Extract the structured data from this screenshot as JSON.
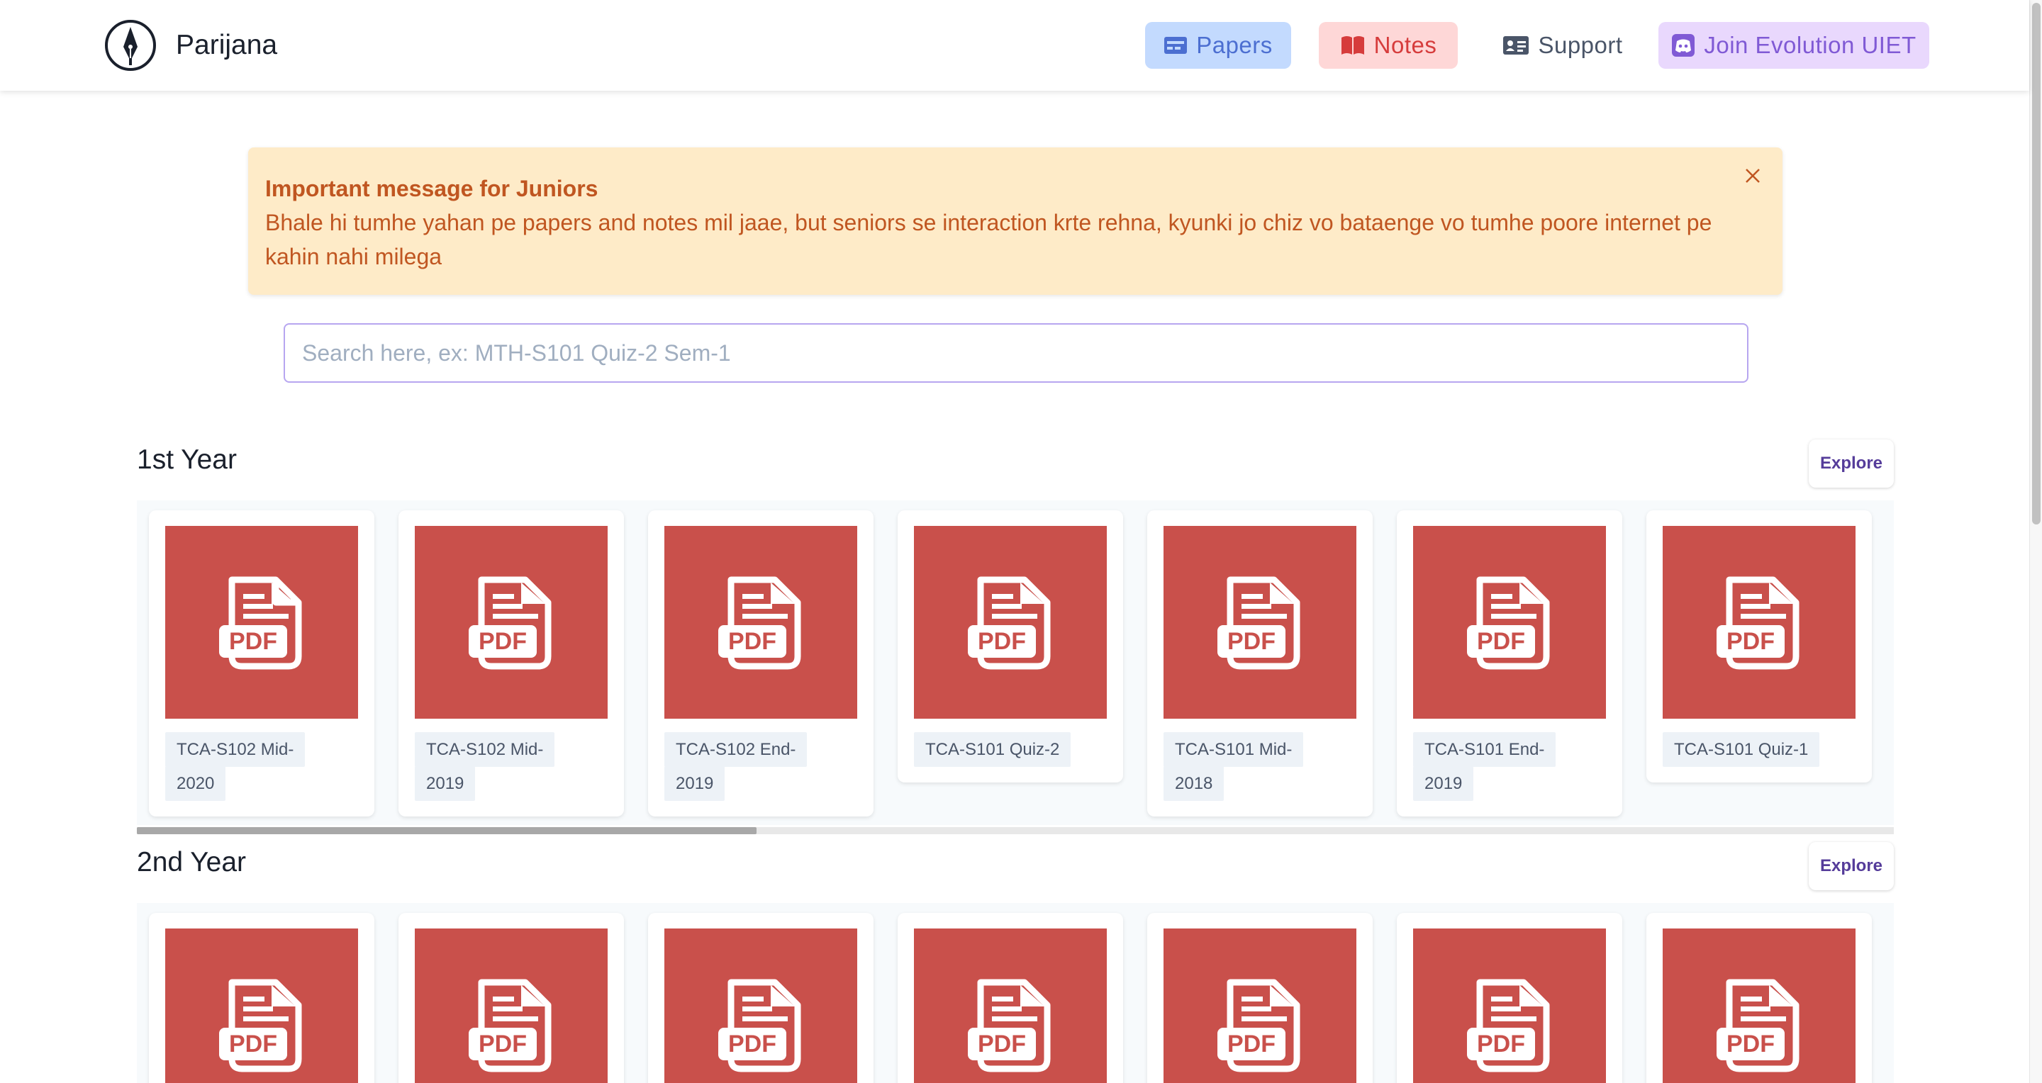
{
  "header": {
    "brand": "Parijana",
    "nav": {
      "papers": "Papers",
      "notes": "Notes",
      "support": "Support",
      "join": "Join Evolution UIET"
    }
  },
  "alert": {
    "title": "Important message for Juniors",
    "text": "Bhale hi tumhe yahan pe papers and notes mil jaae, but seniors se interaction krte rehna, kyunki jo chiz vo bataenge vo tumhe poore internet pe kahin nahi milega"
  },
  "search": {
    "placeholder": "Search here, ex: MTH-S101 Quiz-2 Sem-1"
  },
  "sections": [
    {
      "title": "1st Year",
      "explore": "Explore",
      "cards": [
        {
          "label": "TCA-S102 Mid-2020"
        },
        {
          "label": "TCA-S102 Mid-2019"
        },
        {
          "label": "TCA-S102 End-2019"
        },
        {
          "label": "TCA-S101 Quiz-2"
        },
        {
          "label": "TCA-S101 Mid-2018"
        },
        {
          "label": "TCA-S101 End-2019"
        },
        {
          "label": "TCA-S101 Quiz-1"
        }
      ]
    },
    {
      "title": "2nd Year",
      "explore": "Explore",
      "cards": [
        {
          "label": ""
        },
        {
          "label": ""
        },
        {
          "label": ""
        },
        {
          "label": ""
        },
        {
          "label": ""
        },
        {
          "label": ""
        },
        {
          "label": ""
        }
      ]
    }
  ],
  "pdf_icon_text": "PDF",
  "colors": {
    "pdf_bg": "#c9504b",
    "alert_bg": "#feebc8",
    "alert_text": "#c05621",
    "papers_bg": "#c3dafe",
    "notes_bg": "#fed7d7",
    "join_bg": "#e9d8fd"
  },
  "icons": {
    "logo": "pen-nib-icon",
    "papers": "card-icon",
    "notes": "book-icon",
    "support": "id-card-icon",
    "join": "discord-icon",
    "close": "close-icon",
    "pdf": "pdf-file-icon"
  }
}
